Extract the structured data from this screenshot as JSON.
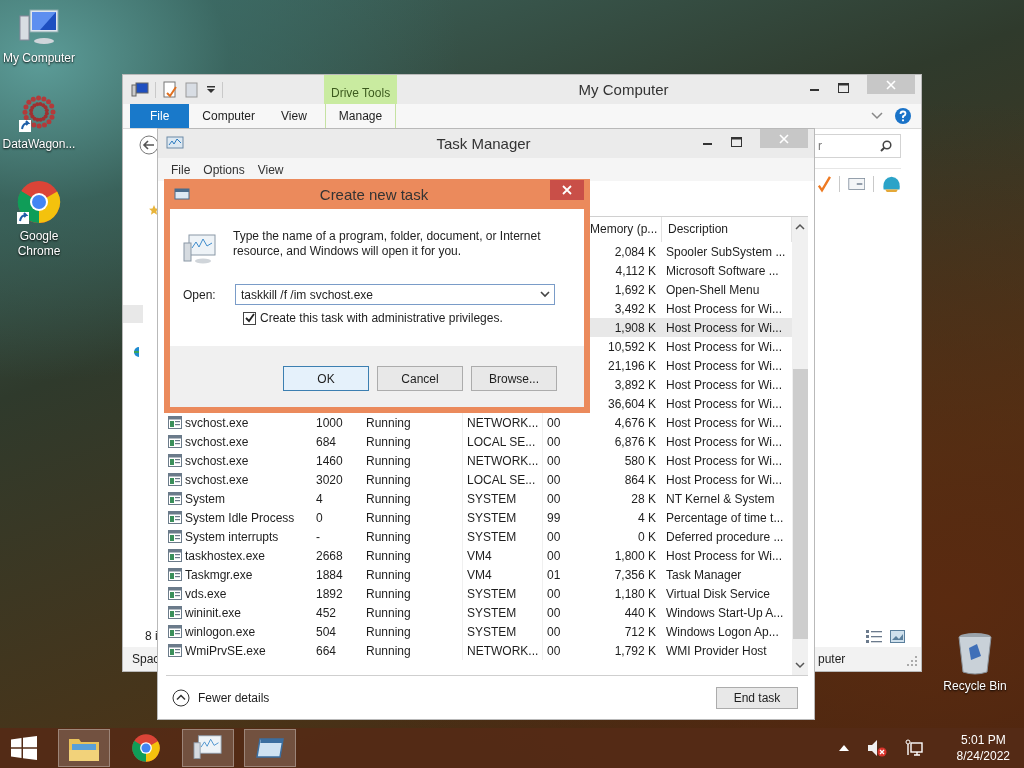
{
  "desktop_icons": [
    {
      "label": "My Computer",
      "kind": "computer",
      "shortcut": false
    },
    {
      "label": "DataWagon...",
      "kind": "app",
      "shortcut": true
    },
    {
      "label": "Google Chrome",
      "kind": "browser",
      "shortcut": true
    }
  ],
  "recycle_bin": {
    "label": "Recycle Bin"
  },
  "explorer_window": {
    "title": "My Computer",
    "contextual_tab": "Drive Tools",
    "ribbon_tabs": [
      {
        "label": "File",
        "kind": "backstage"
      },
      {
        "label": "Computer",
        "kind": "tab"
      },
      {
        "label": "View",
        "kind": "tab"
      },
      {
        "label": "Manage",
        "kind": "contextual"
      }
    ],
    "search": {
      "placeholder": "r"
    },
    "item_count": "8 i",
    "status_left": "Spac",
    "status_right": "puter"
  },
  "task_manager": {
    "title": "Task Manager",
    "menu": [
      "File",
      "Options",
      "View"
    ],
    "columns": [
      "Memory (p...",
      "Description"
    ],
    "rows": [
      {
        "memory": "2,084 K",
        "description": "Spooler SubSystem ...",
        "selected": false
      },
      {
        "memory": "4,112 K",
        "description": "Microsoft Software ...",
        "selected": false
      },
      {
        "memory": "1,692 K",
        "description": "Open-Shell Menu",
        "selected": false
      },
      {
        "memory": "3,492 K",
        "description": "Host Process for Wi...",
        "selected": false
      },
      {
        "memory": "1,908 K",
        "description": "Host Process for Wi...",
        "selected": true
      },
      {
        "memory": "10,592 K",
        "description": "Host Process for Wi...",
        "selected": false
      },
      {
        "memory": "21,196 K",
        "description": "Host Process for Wi...",
        "selected": false
      },
      {
        "memory": "3,892 K",
        "description": "Host Process for Wi...",
        "selected": false
      },
      {
        "memory": "36,604 K",
        "description": "Host Process for Wi...",
        "selected": false
      },
      {
        "column_1": "svchost.exe",
        "column_2": "1000",
        "column_3": "Running",
        "column_4": "NETWORK...",
        "column_5": "00",
        "memory": "4,676 K",
        "description": "Host Process for Wi...",
        "selected": false
      },
      {
        "column_1": "svchost.exe",
        "column_2": "684",
        "column_3": "Running",
        "column_4": "LOCAL SE...",
        "column_5": "00",
        "memory": "6,876 K",
        "description": "Host Process for Wi...",
        "selected": false
      },
      {
        "column_1": "svchost.exe",
        "column_2": "1460",
        "column_3": "Running",
        "column_4": "NETWORK...",
        "column_5": "00",
        "memory": "580 K",
        "description": "Host Process for Wi...",
        "selected": false
      },
      {
        "column_1": "svchost.exe",
        "column_2": "3020",
        "column_3": "Running",
        "column_4": "LOCAL SE...",
        "column_5": "00",
        "memory": "864 K",
        "description": "Host Process for Wi...",
        "selected": false
      },
      {
        "column_1": "System",
        "column_2": "4",
        "column_3": "Running",
        "column_4": "SYSTEM",
        "column_5": "00",
        "memory": "28 K",
        "description": "NT Kernel & System",
        "selected": false
      },
      {
        "column_1": "System Idle Process",
        "column_2": "0",
        "column_3": "Running",
        "column_4": "SYSTEM",
        "column_5": "99",
        "memory": "4 K",
        "description": "Percentage of time t...",
        "selected": false
      },
      {
        "column_1": "System interrupts",
        "column_2": "-",
        "column_3": "Running",
        "column_4": "SYSTEM",
        "column_5": "00",
        "memory": "0 K",
        "description": "Deferred procedure ...",
        "selected": false
      },
      {
        "column_1": "taskhostex.exe",
        "column_2": "2668",
        "column_3": "Running",
        "column_4": "VM4",
        "column_5": "00",
        "memory": "1,800 K",
        "description": "Host Process for Wi...",
        "selected": false
      },
      {
        "column_1": "Taskmgr.exe",
        "column_2": "1884",
        "column_3": "Running",
        "column_4": "VM4",
        "column_5": "01",
        "memory": "7,356 K",
        "description": "Task Manager",
        "selected": false
      },
      {
        "column_1": "vds.exe",
        "column_2": "1892",
        "column_3": "Running",
        "column_4": "SYSTEM",
        "column_5": "00",
        "memory": "1,180 K",
        "description": "Virtual Disk Service",
        "selected": false
      },
      {
        "column_1": "wininit.exe",
        "column_2": "452",
        "column_3": "Running",
        "column_4": "SYSTEM",
        "column_5": "00",
        "memory": "440 K",
        "description": "Windows Start-Up A...",
        "selected": false
      },
      {
        "column_1": "winlogon.exe",
        "column_2": "504",
        "column_3": "Running",
        "column_4": "SYSTEM",
        "column_5": "00",
        "memory": "712 K",
        "description": "Windows Logon Ap...",
        "selected": false
      },
      {
        "column_1": "WmiPrvSE.exe",
        "column_2": "664",
        "column_3": "Running",
        "column_4": "NETWORK...",
        "column_5": "00",
        "memory": "1,792 K",
        "description": "WMI Provider Host",
        "selected": false
      }
    ],
    "fewer_details": "Fewer details",
    "end_task": "End task"
  },
  "dialog": {
    "title": "Create new task",
    "message": "Type the name of a program, folder, document, or Internet resource, and Windows will open it for you.",
    "open_label": "Open:",
    "open_value": "taskkill /f /im svchost.exe",
    "admin_checkbox": {
      "label": "Create this task with administrative privileges.",
      "checked": true
    },
    "buttons": [
      {
        "label": "OK",
        "default": true
      },
      {
        "label": "Cancel",
        "default": false
      },
      {
        "label": "Browse...",
        "default": false
      }
    ]
  },
  "taskbar": {
    "apps": [
      {
        "kind": "explorer",
        "running": true
      },
      {
        "kind": "browser",
        "running": false
      },
      {
        "kind": "monitor",
        "running": true
      },
      {
        "kind": "window",
        "running": true
      }
    ],
    "clock": {
      "time": "5:01 PM",
      "date": "8/24/2022"
    }
  }
}
